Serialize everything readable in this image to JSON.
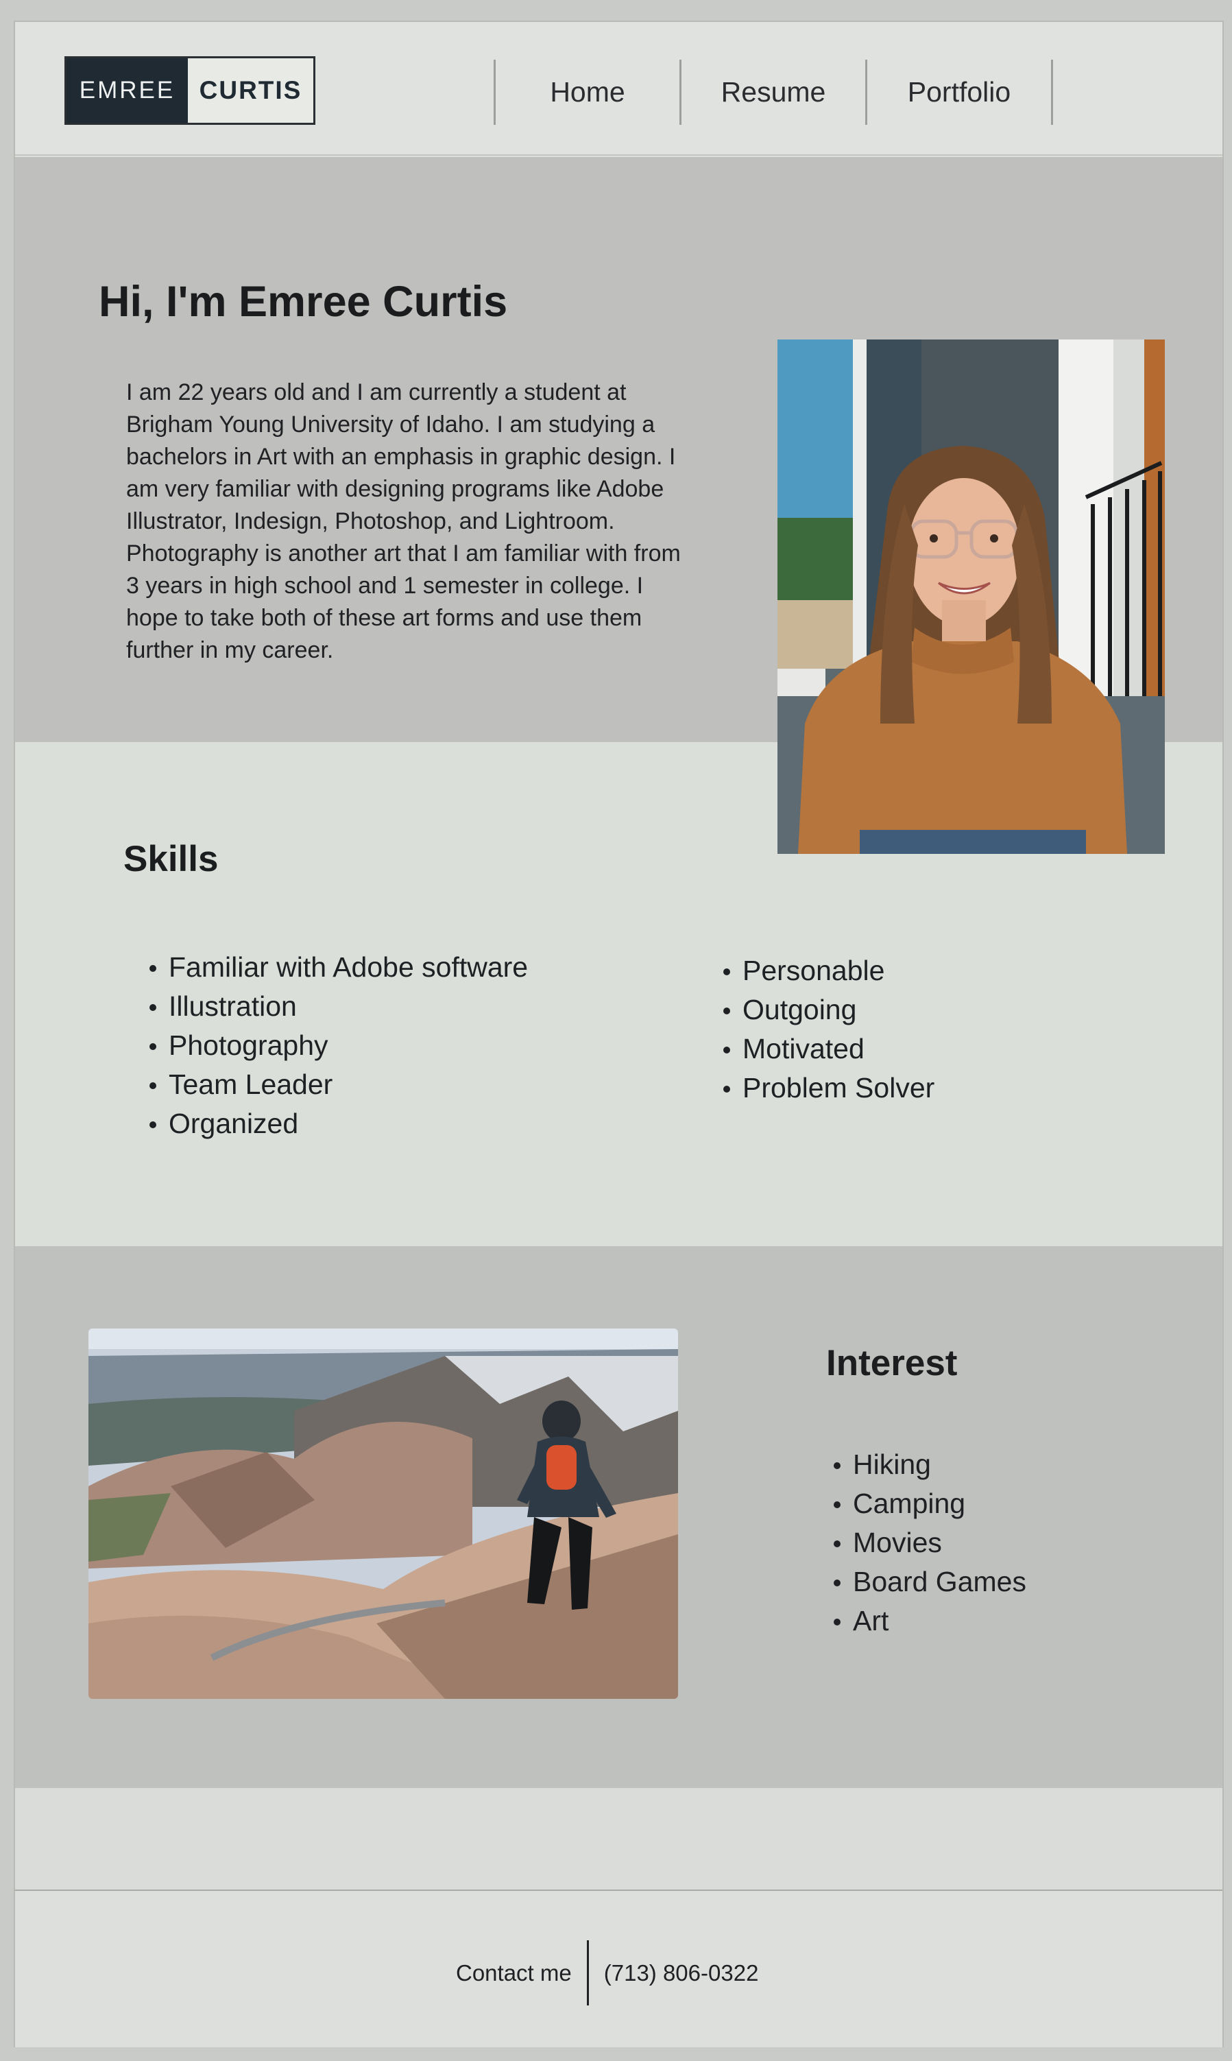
{
  "header": {
    "logo_first": "EMREE",
    "logo_last": "CURTIS",
    "nav": [
      "Home",
      "Resume",
      "Portfolio"
    ]
  },
  "hero": {
    "title": "Hi, I'm Emree Curtis",
    "lines": [
      "I am 22 years old and I am currently a student at",
      "Brigham Young University of Idaho. I am studying a",
      "bachelors in Art with an emphasis in graphic design. I",
      "am very familiar with designing programs like Adobe",
      "Illustrator, Indesign, Photoshop, and Lightroom.",
      "Photography is another art that I am familiar with from",
      "3 years in high school and 1 semester in college. I",
      "hope to take both of these art forms and use them",
      "further in my career."
    ]
  },
  "skills": {
    "title": "Skills",
    "col1": [
      "Familiar with Adobe software",
      "Illustration",
      "Photography",
      "Team Leader",
      "Organized"
    ],
    "col2": [
      "Personable",
      "Outgoing",
      "Motivated",
      "Problem Solver"
    ]
  },
  "interest": {
    "title": "Interest",
    "items": [
      "Hiking",
      "Camping",
      "Movies",
      "Board Games",
      "Art"
    ]
  },
  "footer": {
    "contact_label": "Contact me",
    "phone": "(713) 806-0322"
  }
}
